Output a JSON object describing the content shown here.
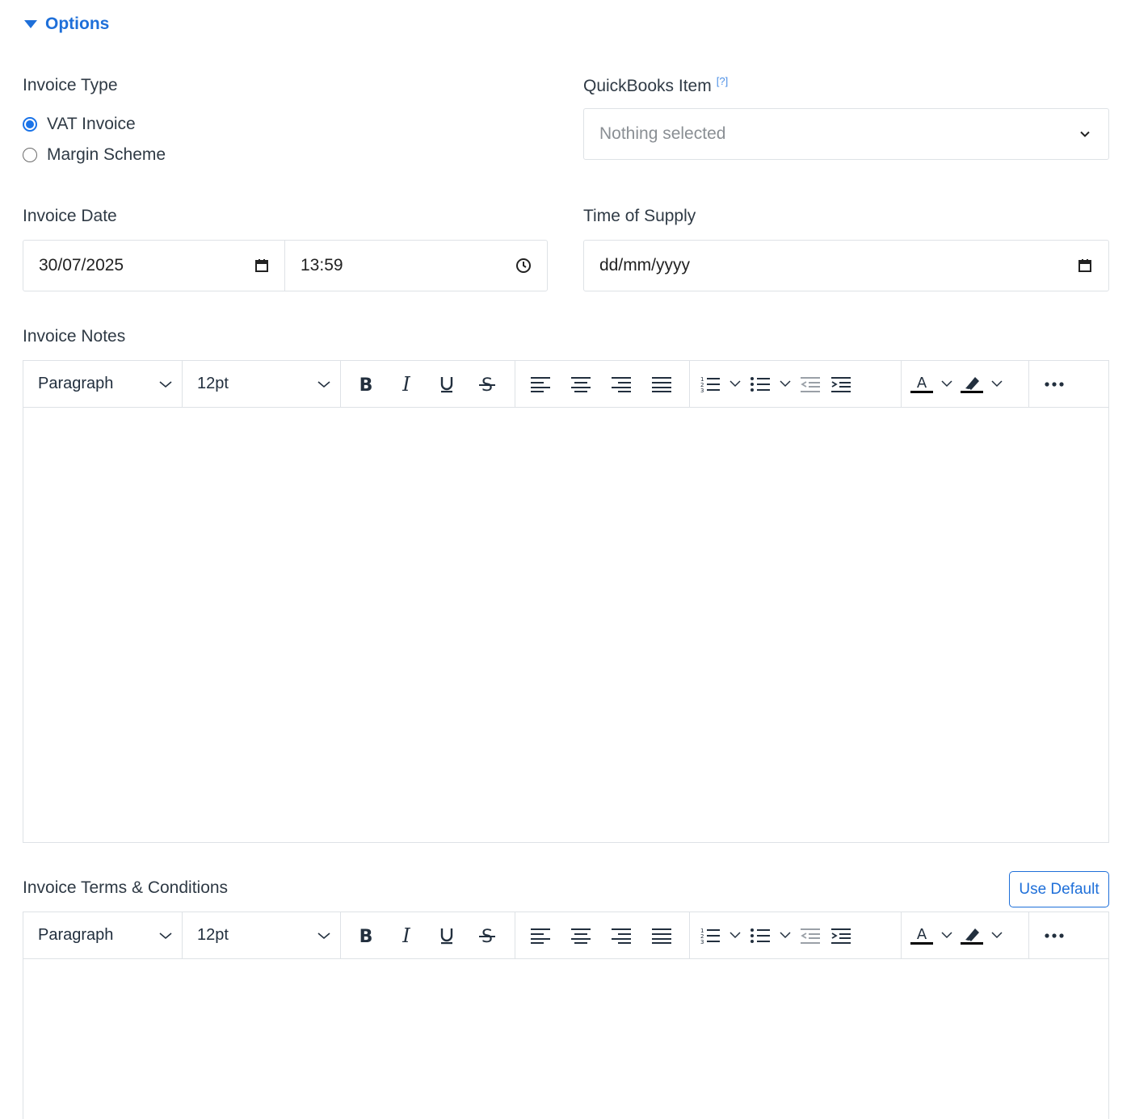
{
  "options": {
    "label": "Options"
  },
  "invoice_type": {
    "label": "Invoice Type",
    "options": [
      {
        "label": "VAT Invoice",
        "checked": true
      },
      {
        "label": "Margin Scheme",
        "checked": false
      }
    ]
  },
  "quickbooks": {
    "label": "QuickBooks Item",
    "help": "[?]",
    "placeholder": "Nothing selected"
  },
  "invoice_date": {
    "label": "Invoice Date",
    "date": "30/07/2025",
    "time": "13:59"
  },
  "time_of_supply": {
    "label": "Time of Supply",
    "placeholder": "dd/mm/yyyy"
  },
  "notes_editor": {
    "label": "Invoice Notes",
    "block_format": "Paragraph",
    "font_size": "12pt",
    "content": ""
  },
  "terms_editor": {
    "label": "Invoice Terms & Conditions",
    "use_default": "Use Default",
    "block_format": "Paragraph",
    "font_size": "12pt",
    "content": ""
  },
  "colors": {
    "accent": "#1e6fd9",
    "border": "#dee2e6",
    "text": "#2f3a45"
  }
}
